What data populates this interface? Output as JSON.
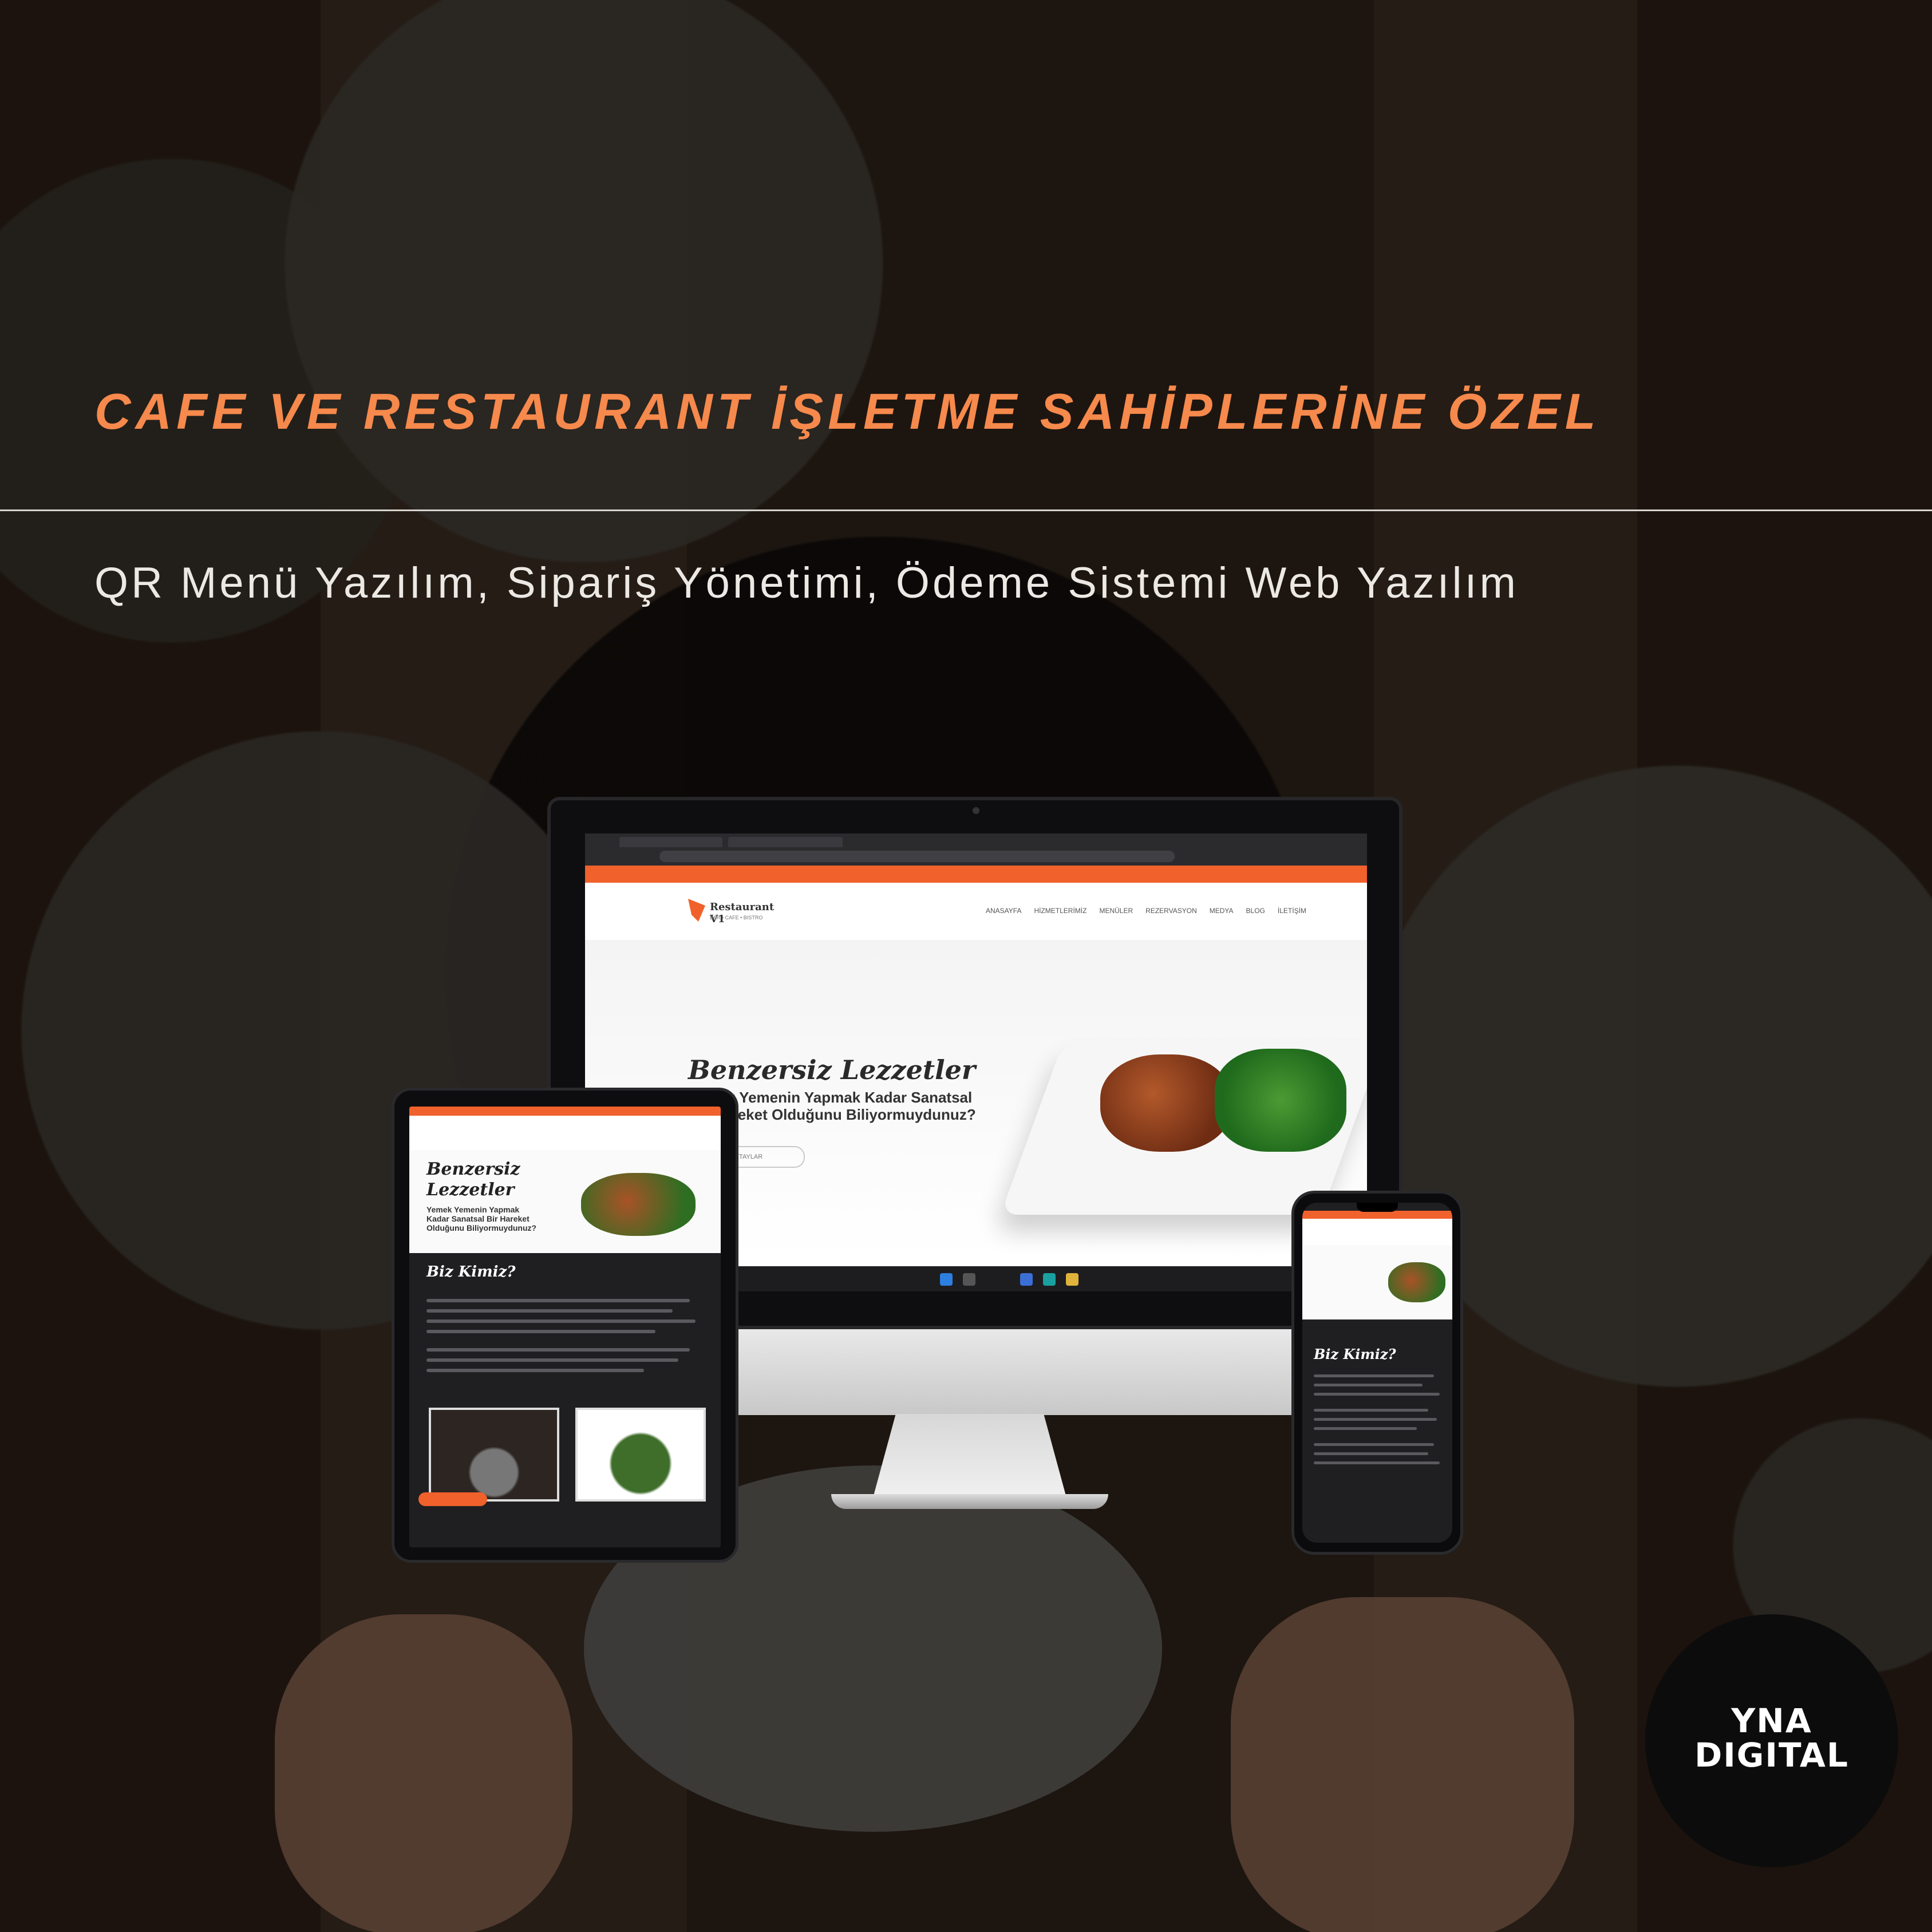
{
  "headline": "CAFE VE RESTAURANT İŞLETME SAHİPLERİNE ÖZEL",
  "subheadline": "QR Menü Yazılım, Sipariş Yönetimi, Ödeme Sistemi Web Yazılım",
  "colors": {
    "accent": "#f6894c",
    "brand_orange": "#f0612b",
    "badge_bg": "#0c0c0c"
  },
  "desktop_site": {
    "logo_text": "Restaurant V1",
    "logo_subtitle": "BAR • CAFE • BISTRO",
    "nav": [
      "ANASAYFA",
      "HİZMETLERİMİZ",
      "MENÜLER",
      "REZERVASYON",
      "MEDYA",
      "BLOG",
      "İLETİŞİM"
    ],
    "hero_title": "Benzersiz Lezzetler",
    "hero_text": "Yemek Yemenin Yapmak Kadar Sanatsal Bir Hareket Olduğunu Biliyormuydunuz?",
    "hero_button": "DETAYLAR"
  },
  "tablet_site": {
    "hero_title": "Benzersiz Lezzetler",
    "hero_text": "Yemek Yemenin Yapmak Kadar Sanatsal Bir Hareket Olduğunu Biliyormuydunuz?",
    "section_title": "Biz Kimiz?"
  },
  "phone_site": {
    "section_title": "Biz Kimiz?"
  },
  "badge": {
    "line1": "YNA",
    "line2": "DIGITAL"
  }
}
